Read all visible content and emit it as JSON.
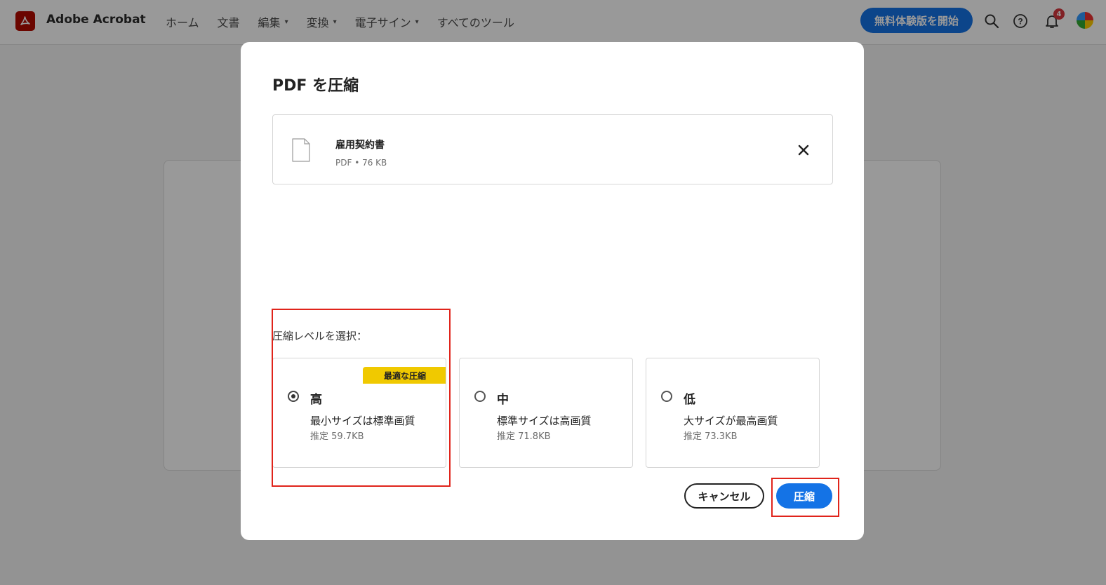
{
  "app": {
    "title": "Adobe Acrobat",
    "nav": [
      {
        "label": "ホーム",
        "has_menu": false
      },
      {
        "label": "文書",
        "has_menu": false
      },
      {
        "label": "編集",
        "has_menu": true
      },
      {
        "label": "変換",
        "has_menu": true
      },
      {
        "label": "電子サイン",
        "has_menu": true
      },
      {
        "label": "すべてのツール",
        "has_menu": false
      }
    ],
    "trial_button": "無料体験版を開始",
    "notification_count": "4",
    "icons": [
      "search-icon",
      "help-icon",
      "bell-icon",
      "avatar"
    ],
    "accent_color": "#1473e6",
    "brand_color": "#b30b00"
  },
  "dialog": {
    "title": "PDF を圧縮",
    "file": {
      "name": "雇用契約書",
      "meta": "PDF • 76 KB"
    },
    "level_label": "圧縮レベルを選択：",
    "options": [
      {
        "title": "高",
        "badge": "最適な圧縮",
        "description": "最小サイズは標準画質",
        "estimate": "推定 59.7KB",
        "selected": true
      },
      {
        "title": "中",
        "description": "標準サイズは高画質",
        "estimate": "推定 71.8KB",
        "selected": false
      },
      {
        "title": "低",
        "description": "大サイズが最高画質",
        "estimate": "推定 73.3KB",
        "selected": false
      }
    ],
    "cancel_label": "キャンセル",
    "compress_label": "圧縮"
  }
}
